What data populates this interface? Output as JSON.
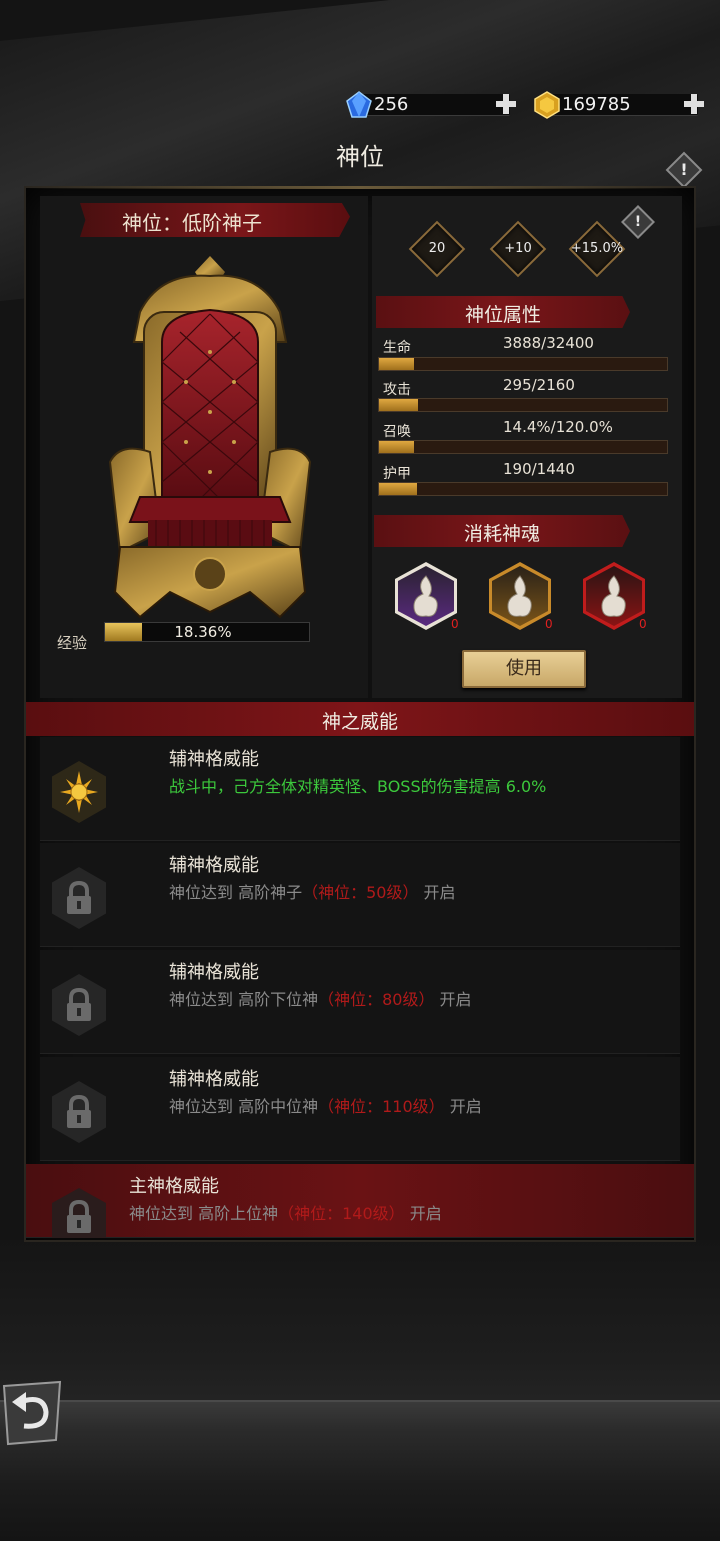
{
  "currency": {
    "gems": {
      "icon": "blue-gem-icon",
      "value": "256"
    },
    "gold": {
      "icon": "gold-coin-icon",
      "value": "169785"
    }
  },
  "page": {
    "title": "神位"
  },
  "rank": {
    "label": "神位：低阶神子"
  },
  "exp": {
    "label": "经验",
    "text": "18.36%",
    "percent": 18.36
  },
  "bonuses": [
    {
      "text": "20"
    },
    {
      "text": "+10"
    },
    {
      "text": "+15.0%"
    }
  ],
  "attributes": {
    "title": "神位属性",
    "items": [
      {
        "name": "生命",
        "value": "3888/32400",
        "fraction": 0.12
      },
      {
        "name": "攻击",
        "value": "295/2160",
        "fraction": 0.137
      },
      {
        "name": "召唤",
        "value": "14.4%/120.0%",
        "fraction": 0.12
      },
      {
        "name": "护甲",
        "value": "190/1440",
        "fraction": 0.132
      }
    ]
  },
  "souls": {
    "title": "消耗神魂",
    "items": [
      {
        "color": "#8a3ab0",
        "count": "0"
      },
      {
        "color": "#c88a2a",
        "count": "0"
      },
      {
        "color": "#c01c1c",
        "count": "0"
      }
    ],
    "use_label": "使用"
  },
  "powers": {
    "title": "神之威能",
    "items": [
      {
        "title": "辅神格威能",
        "desc": "战斗中，己方全体对精英怪、BOSS的伤害提高 6.0%",
        "unlocked": true
      },
      {
        "title": "辅神格威能",
        "desc_pre": "神位达到 高阶神子",
        "desc_req": "（神位：50级）",
        "desc_post": " 开启"
      },
      {
        "title": "辅神格威能",
        "desc_pre": "神位达到 高阶下位神",
        "desc_req": "（神位：80级）",
        "desc_post": " 开启"
      },
      {
        "title": "辅神格威能",
        "desc_pre": "神位达到 高阶中位神",
        "desc_req": "（神位：110级）",
        "desc_post": " 开启"
      },
      {
        "title": "主神格威能",
        "desc_pre": "神位达到 高阶上位神",
        "desc_req": "（神位：140级）",
        "desc_post": " 开启"
      }
    ]
  }
}
